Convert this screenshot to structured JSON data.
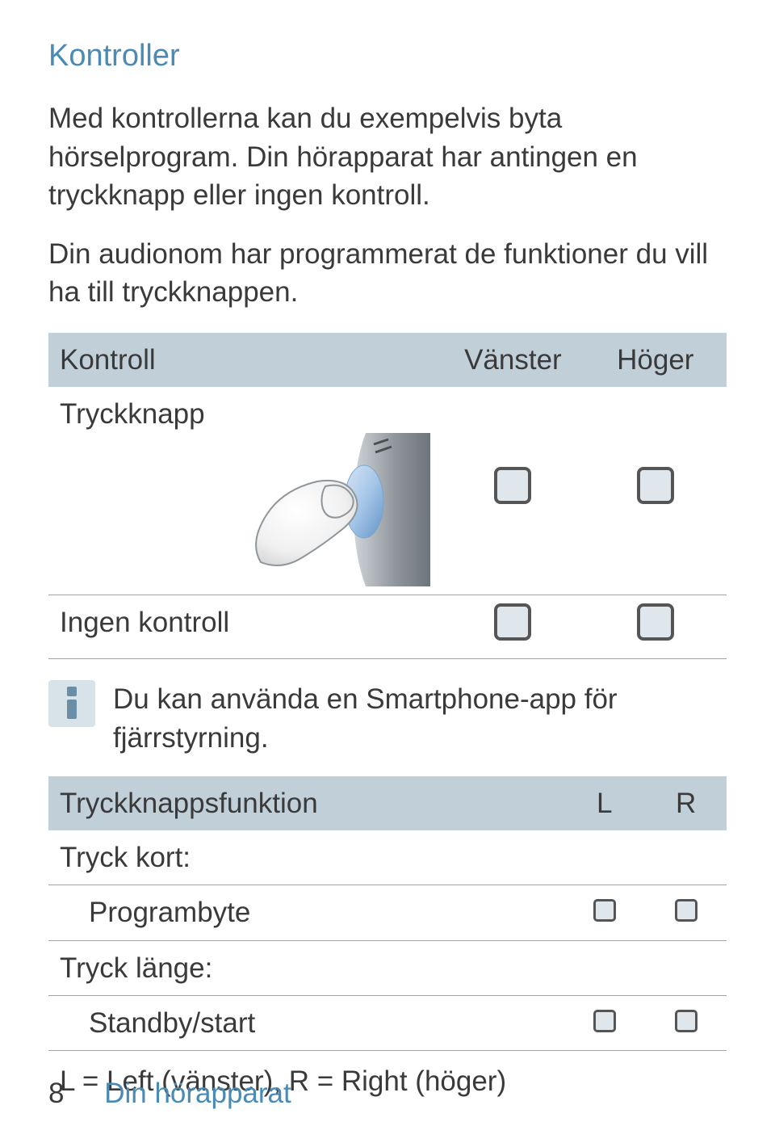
{
  "heading": "Kontroller",
  "paragraph1": "Med kontrollerna kan du exempelvis byta hörselprogram. Din hörapparat har antingen en tryckknapp eller ingen kontroll.",
  "paragraph2": "Din audionom har programmerat de funktioner du vill ha till tryckknappen.",
  "table1": {
    "head": {
      "c1": "Kontroll",
      "c2": "Vänster",
      "c3": "Höger"
    },
    "row_press": "Tryckknapp",
    "row_none": "Ingen kontroll"
  },
  "info_text": "Du kan använda en Smartphone-app för fjärrstyrning.",
  "table2": {
    "head": {
      "c1": "Tryckknappsfunktion",
      "c2": "L",
      "c3": "R"
    },
    "row_short": "Tryck kort:",
    "row_program": "Programbyte",
    "row_long": "Tryck länge:",
    "row_standby": "Standby/start"
  },
  "legend": "L = Left (vänster), R = Right (höger)",
  "footer": {
    "page": "8",
    "section": "Din hörapparat"
  }
}
